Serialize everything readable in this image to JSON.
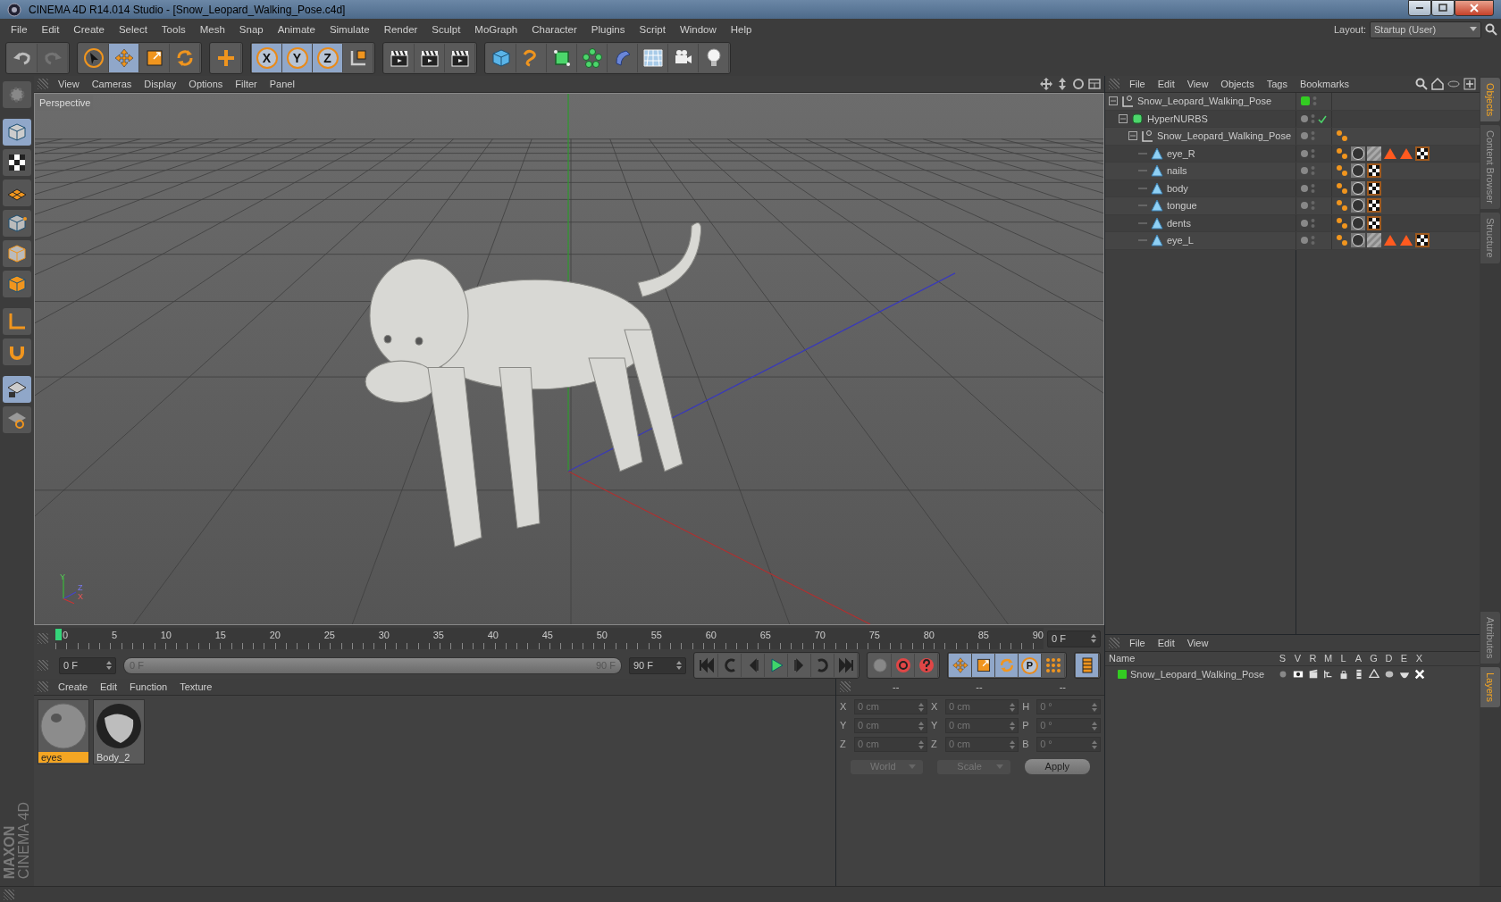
{
  "window": {
    "title": "CINEMA 4D R14.014 Studio - [Snow_Leopard_Walking_Pose.c4d]"
  },
  "menu": [
    "File",
    "Edit",
    "Create",
    "Select",
    "Tools",
    "Mesh",
    "Snap",
    "Animate",
    "Simulate",
    "Render",
    "Sculpt",
    "MoGraph",
    "Character",
    "Plugins",
    "Script",
    "Window",
    "Help"
  ],
  "layout": {
    "label": "Layout:",
    "value": "Startup (User)"
  },
  "toolbar": [
    [
      {
        "selected": false,
        "disabled": false
      },
      {
        "selected": false,
        "disabled": true
      }
    ],
    [
      {
        "selected": false,
        "disabled": false
      },
      {
        "selected": true,
        "disabled": false
      },
      {
        "selected": false,
        "disabled": false
      },
      {
        "selected": false,
        "disabled": false
      }
    ],
    [
      {
        "selected": false,
        "disabled": false
      }
    ],
    [
      {
        "selected": true,
        "disabled": false,
        "label": "X"
      },
      {
        "selected": true,
        "disabled": false,
        "label": "Y"
      },
      {
        "selected": true,
        "disabled": false,
        "label": "Z"
      },
      {
        "selected": false,
        "disabled": false
      }
    ],
    [
      {
        "selected": false,
        "disabled": false
      },
      {
        "selected": false,
        "disabled": false
      },
      {
        "selected": false,
        "disabled": false
      }
    ],
    [
      {
        "selected": false,
        "disabled": false
      },
      {
        "selected": false,
        "disabled": false
      },
      {
        "selected": false,
        "disabled": false
      },
      {
        "selected": false,
        "disabled": false
      },
      {
        "selected": false,
        "disabled": false
      },
      {
        "selected": false,
        "disabled": false
      },
      {
        "selected": false,
        "disabled": false
      },
      {
        "selected": false,
        "disabled": false
      }
    ]
  ],
  "left_tools": [
    {
      "selected": false
    },
    {
      "selected": true
    },
    {
      "selected": false
    },
    {
      "selected": false
    },
    {
      "selected": false
    },
    {
      "selected": false
    },
    {
      "selected": false
    },
    {
      "selected": false
    },
    {
      "selected": false
    },
    {
      "selected": true
    },
    {
      "selected": false
    }
  ],
  "brand": {
    "line1": "MAXON",
    "line2": "CINEMA 4D"
  },
  "viewport": {
    "menu": [
      "View",
      "Cameras",
      "Display",
      "Options",
      "Filter",
      "Panel"
    ],
    "camera": "Perspective",
    "gizmo_labels": [
      "Y",
      "Z",
      "X"
    ]
  },
  "timeline": {
    "labels": [
      "0",
      "5",
      "10",
      "15",
      "20",
      "25",
      "30",
      "35",
      "40",
      "45",
      "50",
      "55",
      "60",
      "65",
      "70",
      "75",
      "80",
      "85",
      "90"
    ],
    "playhead": {
      "level": 0
    },
    "current_frame": "0 F"
  },
  "transport": {
    "start": "0 F",
    "range": {
      "start": "0 F",
      "end": "90 F",
      "level": 1
    },
    "end": "90 F",
    "groups": [
      [
        {
          "selected": false
        },
        {
          "selected": false
        },
        {
          "selected": false
        },
        {
          "selected": false
        },
        {
          "selected": false
        },
        {
          "selected": false
        },
        {
          "selected": false
        }
      ],
      [
        {
          "selected": false
        },
        {
          "selected": false
        },
        {
          "selected": false
        }
      ],
      [
        {
          "selected": true
        },
        {
          "selected": true
        },
        {
          "selected": true
        },
        {
          "selected": true,
          "label": "P"
        },
        {
          "selected": false
        }
      ],
      [
        {
          "selected": true
        }
      ]
    ]
  },
  "materials": {
    "menu": [
      "Create",
      "Edit",
      "Function",
      "Texture"
    ],
    "items": [
      {
        "name": "eyes",
        "selected": true
      },
      {
        "name": "Body_2",
        "selected": false
      }
    ]
  },
  "coordinates": {
    "columns": [
      {
        "header": "--",
        "fields": [
          {
            "label": "X",
            "value": "0 cm"
          },
          {
            "label": "Y",
            "value": "0 cm"
          },
          {
            "label": "Z",
            "value": "0 cm"
          }
        ]
      },
      {
        "header": "--",
        "fields": [
          {
            "label": "X",
            "value": "0 cm"
          },
          {
            "label": "Y",
            "value": "0 cm"
          },
          {
            "label": "Z",
            "value": "0 cm"
          }
        ]
      },
      {
        "header": "--",
        "fields": [
          {
            "label": "H",
            "value": "0 °"
          },
          {
            "label": "P",
            "value": "0 °"
          },
          {
            "label": "B",
            "value": "0 °"
          }
        ]
      }
    ],
    "dropdowns": [
      {
        "value": "World",
        "disabled": true
      },
      {
        "value": "Scale",
        "disabled": true
      }
    ],
    "apply": "Apply"
  },
  "objects": {
    "menu": [
      "File",
      "Edit",
      "View",
      "Objects",
      "Tags",
      "Bookmarks"
    ],
    "tree": [
      {
        "name": "Snow_Leopard_Walking_Pose",
        "kind": "null",
        "color": "#33cc22",
        "checked": false,
        "children": [
          {
            "name": "HyperNURBS",
            "kind": "generator",
            "checked": true,
            "children": [
              {
                "name": "Snow_Leopard_Walking_Pose",
                "kind": "null",
                "checked": false,
                "tags": [
                  {
                    "kind": "phong"
                  }
                ],
                "children": [
                  {
                    "name": "eye_R",
                    "kind": "polygon",
                    "checked": false,
                    "tags": [
                      {
                        "kind": "phong"
                      },
                      {
                        "kind": "material"
                      },
                      {
                        "kind": "stripes"
                      },
                      {
                        "kind": "warning"
                      },
                      {
                        "kind": "warning"
                      },
                      {
                        "kind": "checker"
                      }
                    ]
                  },
                  {
                    "name": "nails",
                    "kind": "polygon",
                    "checked": false,
                    "tags": [
                      {
                        "kind": "phong"
                      },
                      {
                        "kind": "material"
                      },
                      {
                        "kind": "checker"
                      }
                    ]
                  },
                  {
                    "name": "body",
                    "kind": "polygon",
                    "checked": false,
                    "tags": [
                      {
                        "kind": "phong"
                      },
                      {
                        "kind": "material"
                      },
                      {
                        "kind": "checker"
                      }
                    ]
                  },
                  {
                    "name": "tongue",
                    "kind": "polygon",
                    "checked": false,
                    "tags": [
                      {
                        "kind": "phong"
                      },
                      {
                        "kind": "material"
                      },
                      {
                        "kind": "checker"
                      }
                    ]
                  },
                  {
                    "name": "dents",
                    "kind": "polygon",
                    "checked": false,
                    "tags": [
                      {
                        "kind": "phong"
                      },
                      {
                        "kind": "material"
                      },
                      {
                        "kind": "checker"
                      }
                    ]
                  },
                  {
                    "name": "eye_L",
                    "kind": "polygon",
                    "checked": false,
                    "tags": [
                      {
                        "kind": "phong"
                      },
                      {
                        "kind": "material"
                      },
                      {
                        "kind": "stripes"
                      },
                      {
                        "kind": "warning"
                      },
                      {
                        "kind": "warning"
                      },
                      {
                        "kind": "checker"
                      }
                    ]
                  }
                ]
              }
            ]
          }
        ]
      }
    ]
  },
  "layers": {
    "menu": [
      "File",
      "Edit",
      "View"
    ],
    "columns": [
      "Name",
      "S",
      "V",
      "R",
      "M",
      "L",
      "A",
      "G",
      "D",
      "E",
      "X"
    ],
    "rows": [
      {
        "name": "Snow_Leopard_Walking_Pose",
        "color": "#33cc22"
      }
    ]
  },
  "side_tabs": {
    "top": [
      {
        "label": "Objects",
        "selected": true
      },
      {
        "label": "Content Browser",
        "selected": false
      },
      {
        "label": "Structure",
        "selected": false
      }
    ],
    "bottom": [
      {
        "label": "Attributes",
        "selected": false
      },
      {
        "label": "Layers",
        "selected": true
      }
    ]
  }
}
